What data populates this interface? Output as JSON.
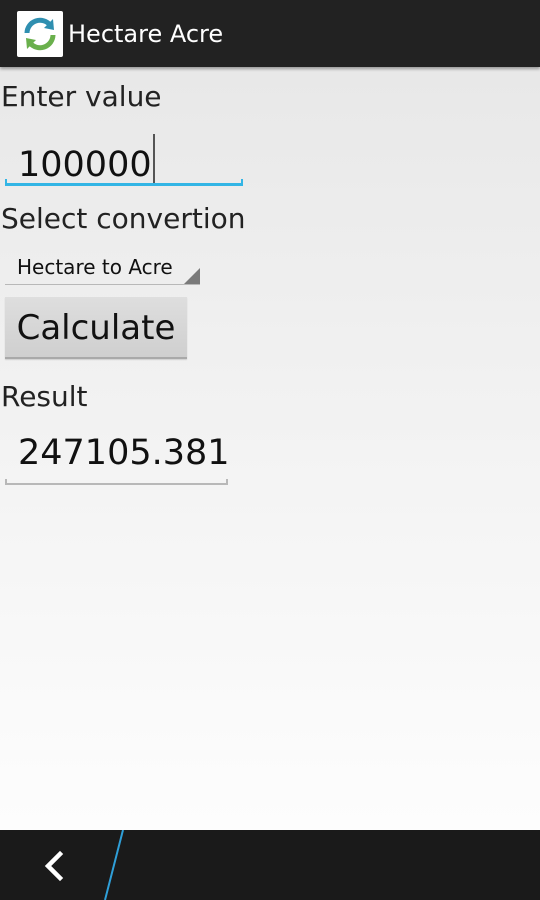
{
  "app": {
    "title": "Hectare Acre",
    "icon": "refresh-arrows-icon"
  },
  "form": {
    "enter_label": "Enter value",
    "input_value": "100000",
    "select_label": "Select convertion",
    "selected_conversion": "Hectare to Acre",
    "calculate_label": "Calculate",
    "result_label": "Result",
    "result_value": "247105.381"
  },
  "nav": {
    "back_icon": "chevron-left-icon"
  },
  "colors": {
    "action_bar": "#222222",
    "accent": "#33b5e5",
    "button": "#d6d6d6",
    "nav_bar": "#1a1a1a"
  }
}
